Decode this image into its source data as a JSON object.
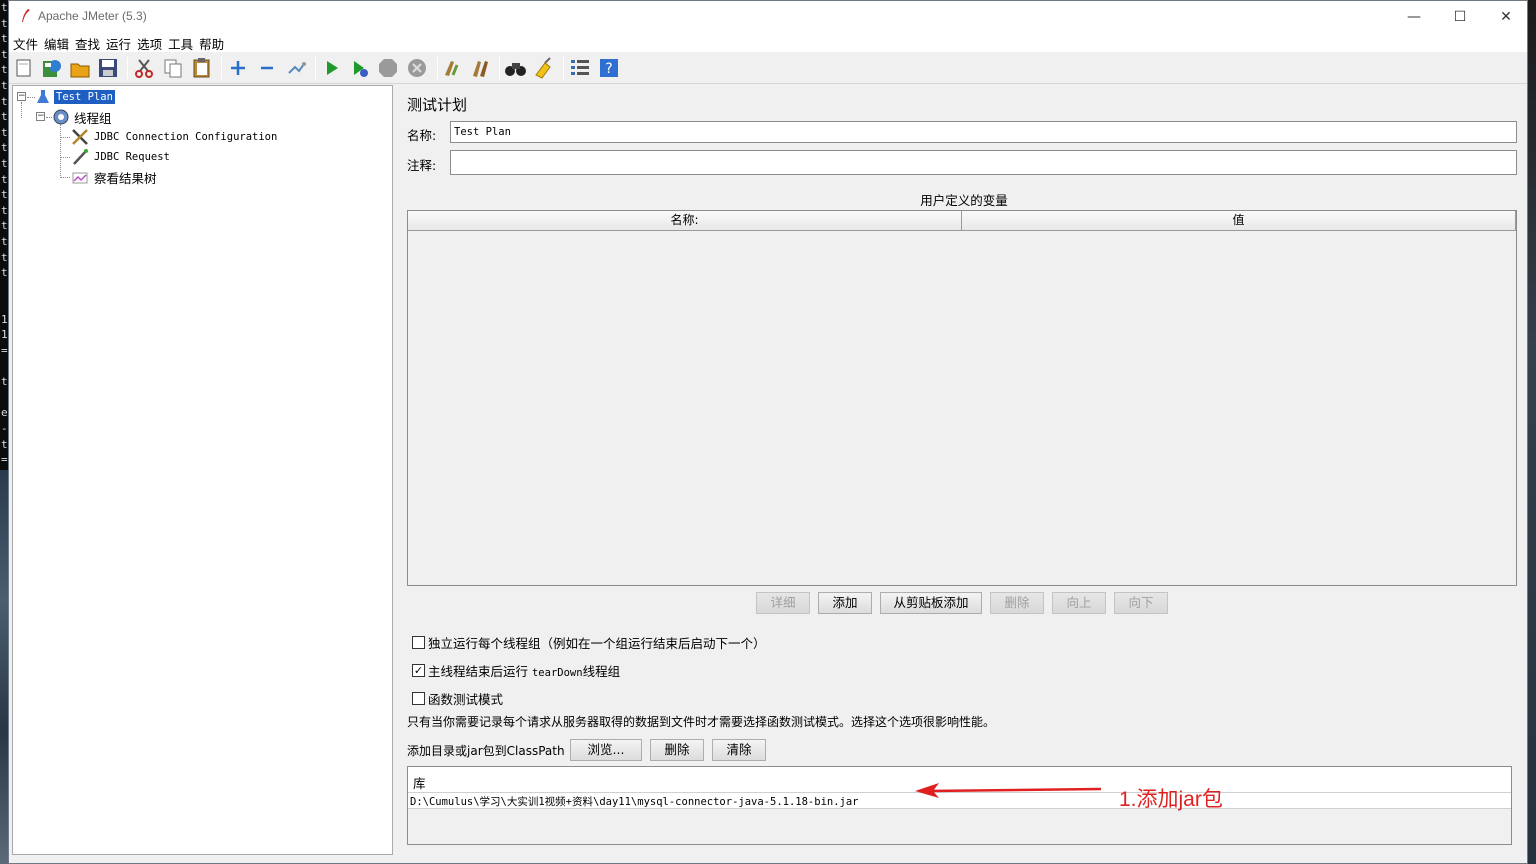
{
  "window": {
    "title": "Apache JMeter (5.3)",
    "minimize_glyph": "—",
    "maximize_glyph": "☐",
    "close_glyph": "✕"
  },
  "terminal_strip": [
    "t",
    "t",
    "t",
    "t",
    "t",
    "t",
    "t",
    "t",
    "t",
    "t",
    "t",
    "t",
    "t",
    "t",
    "t",
    "t",
    "t",
    "t",
    "",
    "",
    "1",
    "1",
    "=",
    "",
    "t",
    "",
    "e",
    "-",
    "t",
    "="
  ],
  "menu": [
    "文件",
    "编辑",
    "查找",
    "运行",
    "选项",
    "工具",
    "帮助"
  ],
  "toolbar": {
    "icons": [
      "new-icon",
      "templates-icon",
      "open-icon",
      "save-icon",
      "cut-icon",
      "copy-icon",
      "paste-icon",
      "expand-icon",
      "collapse-icon",
      "toggle-icon",
      "start-icon",
      "start-no-pause-icon",
      "stop-icon",
      "shutdown-icon",
      "clear-icon",
      "clear-all-icon",
      "search-icon",
      "reset-search-icon",
      "function-helper-icon",
      "help-icon"
    ]
  },
  "tree": {
    "root": "Test Plan",
    "thread_group": "线程组",
    "children": [
      "JDBC Connection Configuration",
      "JDBC Request",
      "察看结果树"
    ]
  },
  "plan": {
    "heading": "测试计划",
    "name_label": "名称:",
    "name_value": "Test Plan",
    "comment_label": "注释:",
    "comment_value": "",
    "vars_title": "用户定义的变量",
    "col_name": "名称:",
    "col_value": "值",
    "buttons": {
      "detail": "详细",
      "add": "添加",
      "add_clipboard": "从剪贴板添加",
      "delete": "删除",
      "up": "向上",
      "down": "向下"
    },
    "opt_serial": "独立运行每个线程组（例如在一个组运行结束后启动下一个）",
    "opt_teardown_pre": "主线程结束后运行 ",
    "opt_teardown_mono": "tearDown",
    "opt_teardown_post": "线程组",
    "opt_functional": "函数测试模式",
    "functional_note": "只有当你需要记录每个请求从服务器取得的数据到文件时才需要选择函数测试模式。选择这个选项很影响性能。",
    "classpath_label": "添加目录或jar包到ClassPath",
    "browse": "浏览...",
    "cp_delete": "删除",
    "cp_clear": "清除",
    "lib_header": "库",
    "lib_path": "D:\\Cumulus\\学习\\大实训1视频+资料\\day11\\mysql-connector-java-5.1.18-bin.jar",
    "serial_checked": false,
    "teardown_checked": true,
    "functional_checked": false
  },
  "annotation": {
    "text": "1.添加jar包",
    "color": "#e02020"
  }
}
